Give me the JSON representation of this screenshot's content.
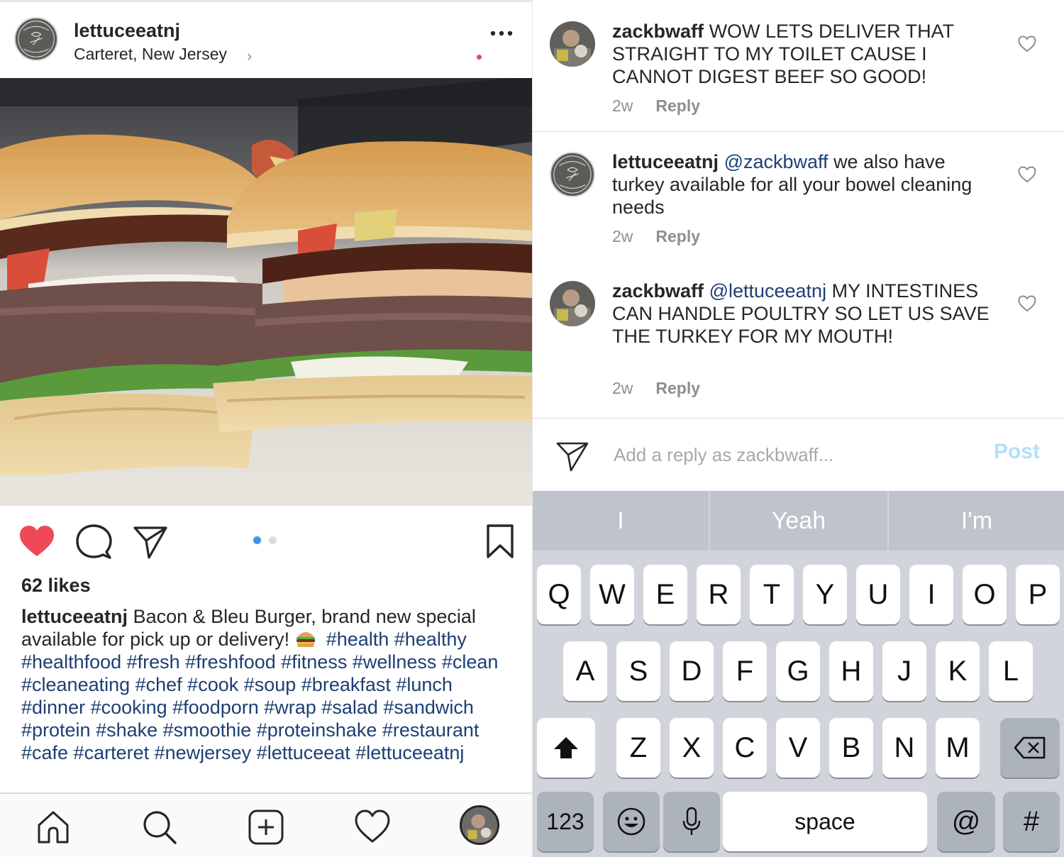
{
  "post": {
    "username": "lettuceeatnj",
    "location": "Carteret, New Jersey",
    "location_chevron": "›",
    "likes": "62 likes",
    "caption_username": "lettuceeatnj",
    "caption_text": "Bacon & Bleu Burger, brand new special available for pick up or delivery!",
    "caption_hashtags": "#health #healthy #healthfood #fresh #freshfood #fitness #wellness #clean #cleaneating #chef #cook #soup #breakfast #lunch #dinner #cooking #foodporn #wrap #salad #sandwich #protein #shake #smoothie #proteinshake #restaurant #cafe #carteret #newjersey #lettuceeat #lettuceeatnj",
    "carousel": {
      "count": 2,
      "active": 1
    },
    "liked": true
  },
  "comments": [
    {
      "username": "zackbwaff",
      "mention": "",
      "text": "WOW LETS DELIVER THAT STRAIGHT TO MY TOILET CAUSE I CANNOT DIGEST BEEF SO GOOD!",
      "time": "2w",
      "reply_label": "Reply",
      "avatar": "zackbwaff-photo"
    },
    {
      "username": "lettuceeatnj",
      "mention": "@zackbwaff",
      "text": "we also have turkey available for all your bowel cleaning needs",
      "time": "2w",
      "reply_label": "Reply",
      "avatar": "lettuceeat-logo"
    },
    {
      "username": "zackbwaff",
      "mention": "@lettuceeatnj",
      "text": "MY INTESTINES CAN HANDLE POULTRY SO LET US SAVE THE TURKEY FOR MY MOUTH!",
      "time": "2w",
      "reply_label": "Reply",
      "avatar": "zackbwaff-photo"
    }
  ],
  "reply": {
    "placeholder": "Add a reply as zackbwaff...",
    "post_label": "Post"
  },
  "keyboard": {
    "suggestions": [
      "I",
      "Yeah",
      "I'm"
    ],
    "row1": [
      "Q",
      "W",
      "E",
      "R",
      "T",
      "Y",
      "U",
      "I",
      "O",
      "P"
    ],
    "row2": [
      "A",
      "S",
      "D",
      "F",
      "G",
      "H",
      "J",
      "K",
      "L"
    ],
    "row3": [
      "Z",
      "X",
      "C",
      "V",
      "B",
      "N",
      "M"
    ],
    "numbers_label": "123",
    "space_label": "space",
    "at_label": "@",
    "hash_label": "#"
  },
  "colors": {
    "like_red": "#ed4956",
    "hashtag_blue": "#1d3f73",
    "post_button_disabled": "#b2dffc",
    "carousel_active": "#3897f0",
    "carousel_inactive": "#dbdbdb",
    "keyboard_bg": "#d1d5db"
  },
  "icons": {
    "more": "ellipsis-icon",
    "like": "heart-filled-icon",
    "comment": "speech-bubble-icon",
    "share": "paper-plane-icon",
    "save": "bookmark-icon",
    "tab_home": "home-icon",
    "tab_search": "search-icon",
    "tab_add": "plus-square-icon",
    "tab_activity": "heart-outline-icon",
    "shift": "shift-arrow-icon",
    "delete": "backspace-icon",
    "emoji": "smiley-icon",
    "dictation": "microphone-icon"
  }
}
